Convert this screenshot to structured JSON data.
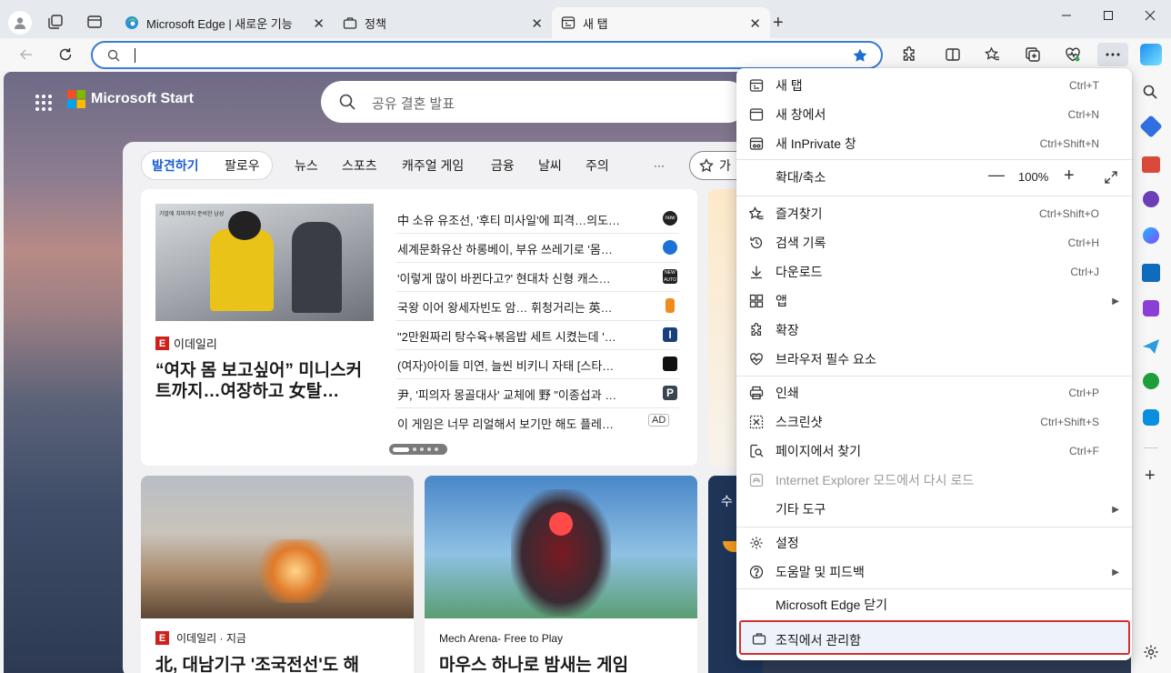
{
  "tabs": [
    {
      "title": "Microsoft Edge | 새로운 기능",
      "icon": "edge-icon"
    },
    {
      "title": "정책",
      "icon": "briefcase-icon"
    },
    {
      "title": "새 탭",
      "icon": "newtab-icon",
      "active": true
    }
  ],
  "address": {
    "value": "",
    "placeholder": ""
  },
  "page": {
    "brand": "Microsoft Start",
    "search_placeholder": "공유 결혼 발표",
    "feed_tabs": [
      "발견하기",
      "팔로우",
      "뉴스",
      "스포츠",
      "캐주얼 게임",
      "금융",
      "날씨",
      "주의",
      "···"
    ],
    "side_tab_peek": "가",
    "featured": {
      "source": "이데일리",
      "headline": "“여자 몸 보고싶어” 미니스커트까지…여장하고 女탈…",
      "img_caption": "가발에 치마까지 준비한 남성"
    },
    "headlines": [
      {
        "text": "中 소유 유조선, '후티 미사일'에 피격…의도…",
        "badge": "now"
      },
      {
        "text": "세계문화유산 하롱베이, 부유 쓰레기로 '몸…",
        "badge": ""
      },
      {
        "text": "'이렇게 많이 바뀐다고?' 현대차 신형 캐스…",
        "badge": "NEW AUTO"
      },
      {
        "text": "국왕 이어 왕세자빈도 암… 휘청거리는 英…",
        "badge": ""
      },
      {
        "text": "\"2만원짜리 탕수육+볶음밥 세트 시켰는데 '…",
        "badge": "I"
      },
      {
        "text": "(여자)아이들 미연, 늘씬 비키니 자태 [스타…",
        "badge": ""
      },
      {
        "text": "尹, '피의자 몽골대사' 교체에 野 \"이종섭과 …",
        "badge": "P"
      },
      {
        "text": "이 게임은 너무 리얼해서 보기만 해도 플레…",
        "badge": "AD"
      }
    ],
    "card1": {
      "source": "이데일리 · 지금",
      "headline": "北, 대남기구 '조국전선'도 해"
    },
    "card2": {
      "source": "Mech Arena- Free to Play",
      "headline": "마우스 하나로 밤새는 게임"
    },
    "card3_peek": "수"
  },
  "menu": {
    "groups": [
      [
        {
          "label": "새 탭",
          "shortcut": "Ctrl+T",
          "icon": "new-tab-icon"
        },
        {
          "label": "새 창에서",
          "shortcut": "Ctrl+N",
          "icon": "new-window-icon"
        },
        {
          "label": "새 InPrivate 창",
          "shortcut": "Ctrl+Shift+N",
          "icon": "inprivate-icon"
        }
      ],
      [
        {
          "label": "확대/축소",
          "zoom": "100%",
          "icon": ""
        }
      ],
      [
        {
          "label": "즐겨찾기",
          "shortcut": "Ctrl+Shift+O",
          "icon": "favorites-icon"
        },
        {
          "label": "검색 기록",
          "shortcut": "Ctrl+H",
          "icon": "history-icon"
        },
        {
          "label": "다운로드",
          "shortcut": "Ctrl+J",
          "icon": "download-icon"
        },
        {
          "label": "앱",
          "submenu": true,
          "icon": "apps-icon"
        },
        {
          "label": "확장",
          "icon": "extensions-icon"
        },
        {
          "label": "브라우저 필수 요소",
          "icon": "heartbeat-icon"
        }
      ],
      [
        {
          "label": "인쇄",
          "shortcut": "Ctrl+P",
          "icon": "print-icon"
        },
        {
          "label": "스크린샷",
          "shortcut": "Ctrl+Shift+S",
          "icon": "screenshot-icon"
        },
        {
          "label": "페이지에서 찾기",
          "shortcut": "Ctrl+F",
          "icon": "find-icon"
        },
        {
          "label": "Internet Explorer 모드에서 다시 로드",
          "disabled": true,
          "icon": "ie-icon"
        },
        {
          "label": "기타 도구",
          "submenu": true,
          "icon": ""
        }
      ],
      [
        {
          "label": "설정",
          "icon": "settings-icon"
        },
        {
          "label": "도움말 및 피드백",
          "submenu": true,
          "icon": "help-icon"
        }
      ],
      [
        {
          "label": "Microsoft Edge 닫기",
          "icon": ""
        }
      ]
    ],
    "managed_label": "조직에서 관리함"
  },
  "colors": {
    "accent": "#3a7bd5",
    "highlight": "#d32f2f",
    "star": "#1a6fd1"
  }
}
